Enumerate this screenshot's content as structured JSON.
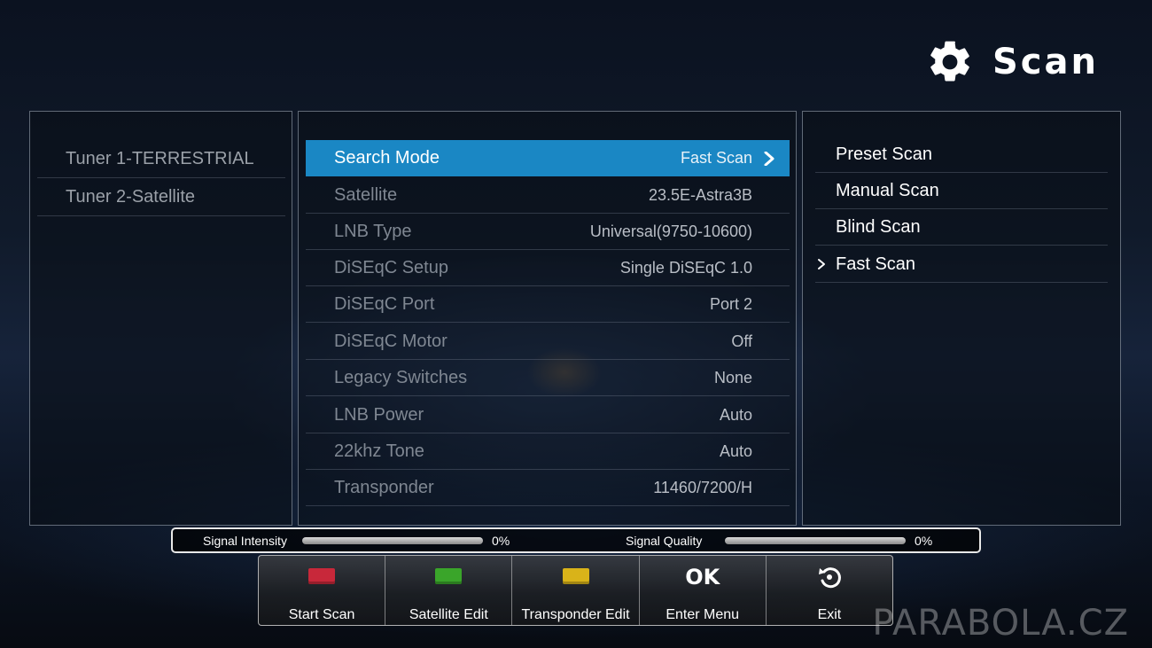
{
  "header": {
    "title": "Scan",
    "icon": "gear-icon"
  },
  "tuners": [
    {
      "label": "Tuner 1-TERRESTRIAL"
    },
    {
      "label": "Tuner 2-Satellite"
    }
  ],
  "settings": [
    {
      "label": "Search Mode",
      "value": "Fast Scan",
      "active": true
    },
    {
      "label": "Satellite",
      "value": "23.5E-Astra3B"
    },
    {
      "label": "LNB Type",
      "value": "Universal(9750-10600)"
    },
    {
      "label": "DiSEqC Setup",
      "value": "Single DiSEqC 1.0"
    },
    {
      "label": "DiSEqC Port",
      "value": "Port 2"
    },
    {
      "label": "DiSEqC Motor",
      "value": "Off"
    },
    {
      "label": "Legacy Switches",
      "value": "None"
    },
    {
      "label": "LNB Power",
      "value": "Auto"
    },
    {
      "label": "22khz Tone",
      "value": "Auto"
    },
    {
      "label": "Transponder",
      "value": "11460/7200/H"
    }
  ],
  "scan_modes": [
    {
      "label": "Preset Scan"
    },
    {
      "label": "Manual Scan"
    },
    {
      "label": "Blind Scan"
    },
    {
      "label": "Fast Scan",
      "selected": true
    }
  ],
  "signal": {
    "intensity_label": "Signal Intensity",
    "intensity_value": "0%",
    "intensity_fraction": 0,
    "quality_label": "Signal Quality",
    "quality_value": "0%",
    "quality_fraction": 0
  },
  "function_keys": [
    {
      "label": "Start Scan",
      "icon": "red-key-icon",
      "color": "#c8283a"
    },
    {
      "label": "Satellite Edit",
      "icon": "green-key-icon",
      "color": "#3aa52a"
    },
    {
      "label": "Transponder Edit",
      "icon": "yellow-key-icon",
      "color": "#d9b319"
    },
    {
      "label": "Enter Menu",
      "icon": "ok-key-icon",
      "key_text": "OK"
    },
    {
      "label": "Exit",
      "icon": "exit-icon"
    }
  ],
  "watermark": "PARABOLA.CZ",
  "colors": {
    "accent": "#1a87c4"
  }
}
